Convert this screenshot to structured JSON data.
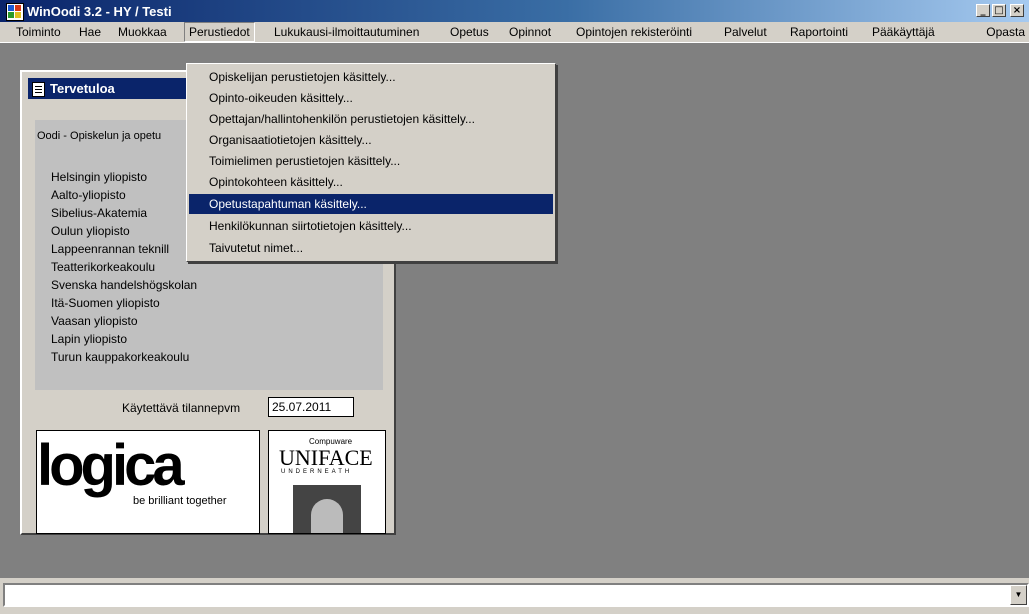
{
  "window": {
    "title": "WinOodi 3.2  -  HY / Testi",
    "controls": {
      "minimize": "_",
      "maximize": "□",
      "close": "×"
    }
  },
  "menubar": {
    "items": [
      "Toiminto",
      "Hae",
      "Muokkaa",
      "Perustiedot",
      "Lukukausi-ilmoittautuminen",
      "Opetus",
      "Opinnot",
      "Opintojen rekisteröinti",
      "Palvelut",
      "Raportointi",
      "Pääkäyttäjä"
    ],
    "right_item": "Opasta",
    "active": "Perustiedot"
  },
  "welcome_window": {
    "title": "Tervetuloa",
    "intro": "Oodi - Opiskelun ja opetu",
    "universities": [
      "Helsingin yliopisto",
      "Aalto-yliopisto",
      "Sibelius-Akatemia",
      "Oulun yliopisto",
      "Lappeenrannan teknill",
      "Teatterikorkeakoulu",
      "Svenska handelshögskolan",
      "Itä-Suomen yliopisto",
      "Vaasan yliopisto",
      "Lapin yliopisto",
      "Turun kauppakorkeakoulu"
    ],
    "date_label": "Käytettävä tilannepvm",
    "date_value": "25.07.2011",
    "logica_logo": {
      "word": "logica",
      "tagline": "be brilliant together"
    },
    "uniface_logo": {
      "top": "Compuware",
      "name": "UNIFACE",
      "sub": "UNDERNEATH"
    }
  },
  "dropdown_menu": {
    "items": [
      "Opiskelijan perustietojen käsittely...",
      "Opinto-oikeuden käsittely...",
      "Opettajan/hallintohenkilön perustietojen käsittely...",
      "Organisaatiotietojen käsittely...",
      "Toimielimen perustietojen käsittely...",
      "Opintokohteen käsittely...",
      "Opetustapahtuman käsittely...",
      "Henkilökunnan siirtotietojen käsittely...",
      "Taivutetut nimet..."
    ],
    "selected_index": 6
  },
  "statusbar": {
    "value": "",
    "dropdown_icon": "chevron-down-icon"
  },
  "colors": {
    "title_active": "#0a246a",
    "face": "#d4d0c8",
    "workspace": "#808080",
    "selection": "#0a246a"
  }
}
